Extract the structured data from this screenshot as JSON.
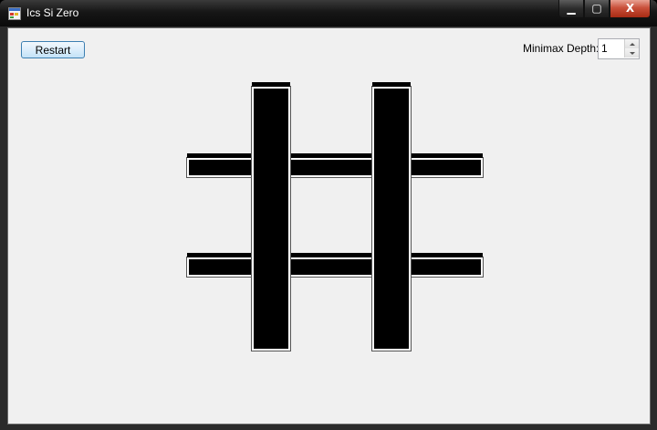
{
  "window": {
    "title": "Ics Si Zero",
    "icon": "app-window-icon",
    "caption_buttons": {
      "minimize_icon": "minimize-icon",
      "maximize_icon": "maximize-icon",
      "close_icon": "close-icon",
      "minimize_glyph": "▁",
      "maximize_glyph": "▢",
      "close_glyph": "X"
    }
  },
  "toolbar": {
    "restart_label": "Restart",
    "depth_label": "Minimax Depth:",
    "depth_value": "1"
  },
  "board": {
    "color": "#000000",
    "outline_color": "#ffffff"
  }
}
